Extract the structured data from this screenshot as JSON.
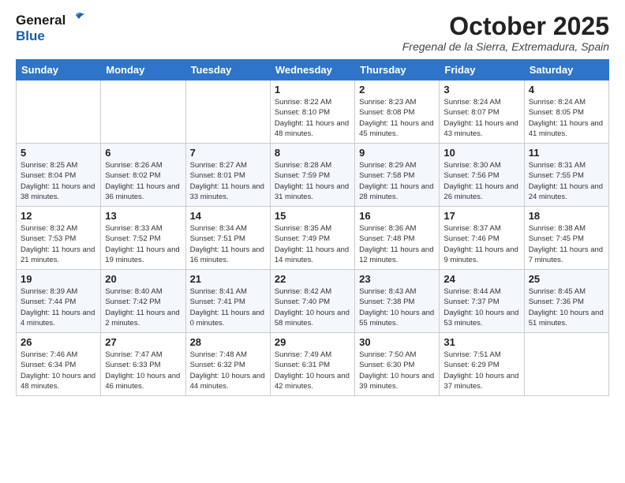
{
  "header": {
    "logo_general": "General",
    "logo_blue": "Blue",
    "month_title": "October 2025",
    "subtitle": "Fregenal de la Sierra, Extremadura, Spain"
  },
  "days_of_week": [
    "Sunday",
    "Monday",
    "Tuesday",
    "Wednesday",
    "Thursday",
    "Friday",
    "Saturday"
  ],
  "weeks": [
    {
      "cells": [
        {
          "day": "",
          "info": ""
        },
        {
          "day": "",
          "info": ""
        },
        {
          "day": "",
          "info": ""
        },
        {
          "day": "1",
          "info": "Sunrise: 8:22 AM\nSunset: 8:10 PM\nDaylight: 11 hours and 48 minutes."
        },
        {
          "day": "2",
          "info": "Sunrise: 8:23 AM\nSunset: 8:08 PM\nDaylight: 11 hours and 45 minutes."
        },
        {
          "day": "3",
          "info": "Sunrise: 8:24 AM\nSunset: 8:07 PM\nDaylight: 11 hours and 43 minutes."
        },
        {
          "day": "4",
          "info": "Sunrise: 8:24 AM\nSunset: 8:05 PM\nDaylight: 11 hours and 41 minutes."
        }
      ]
    },
    {
      "cells": [
        {
          "day": "5",
          "info": "Sunrise: 8:25 AM\nSunset: 8:04 PM\nDaylight: 11 hours and 38 minutes."
        },
        {
          "day": "6",
          "info": "Sunrise: 8:26 AM\nSunset: 8:02 PM\nDaylight: 11 hours and 36 minutes."
        },
        {
          "day": "7",
          "info": "Sunrise: 8:27 AM\nSunset: 8:01 PM\nDaylight: 11 hours and 33 minutes."
        },
        {
          "day": "8",
          "info": "Sunrise: 8:28 AM\nSunset: 7:59 PM\nDaylight: 11 hours and 31 minutes."
        },
        {
          "day": "9",
          "info": "Sunrise: 8:29 AM\nSunset: 7:58 PM\nDaylight: 11 hours and 28 minutes."
        },
        {
          "day": "10",
          "info": "Sunrise: 8:30 AM\nSunset: 7:56 PM\nDaylight: 11 hours and 26 minutes."
        },
        {
          "day": "11",
          "info": "Sunrise: 8:31 AM\nSunset: 7:55 PM\nDaylight: 11 hours and 24 minutes."
        }
      ]
    },
    {
      "cells": [
        {
          "day": "12",
          "info": "Sunrise: 8:32 AM\nSunset: 7:53 PM\nDaylight: 11 hours and 21 minutes."
        },
        {
          "day": "13",
          "info": "Sunrise: 8:33 AM\nSunset: 7:52 PM\nDaylight: 11 hours and 19 minutes."
        },
        {
          "day": "14",
          "info": "Sunrise: 8:34 AM\nSunset: 7:51 PM\nDaylight: 11 hours and 16 minutes."
        },
        {
          "day": "15",
          "info": "Sunrise: 8:35 AM\nSunset: 7:49 PM\nDaylight: 11 hours and 14 minutes."
        },
        {
          "day": "16",
          "info": "Sunrise: 8:36 AM\nSunset: 7:48 PM\nDaylight: 11 hours and 12 minutes."
        },
        {
          "day": "17",
          "info": "Sunrise: 8:37 AM\nSunset: 7:46 PM\nDaylight: 11 hours and 9 minutes."
        },
        {
          "day": "18",
          "info": "Sunrise: 8:38 AM\nSunset: 7:45 PM\nDaylight: 11 hours and 7 minutes."
        }
      ]
    },
    {
      "cells": [
        {
          "day": "19",
          "info": "Sunrise: 8:39 AM\nSunset: 7:44 PM\nDaylight: 11 hours and 4 minutes."
        },
        {
          "day": "20",
          "info": "Sunrise: 8:40 AM\nSunset: 7:42 PM\nDaylight: 11 hours and 2 minutes."
        },
        {
          "day": "21",
          "info": "Sunrise: 8:41 AM\nSunset: 7:41 PM\nDaylight: 11 hours and 0 minutes."
        },
        {
          "day": "22",
          "info": "Sunrise: 8:42 AM\nSunset: 7:40 PM\nDaylight: 10 hours and 58 minutes."
        },
        {
          "day": "23",
          "info": "Sunrise: 8:43 AM\nSunset: 7:38 PM\nDaylight: 10 hours and 55 minutes."
        },
        {
          "day": "24",
          "info": "Sunrise: 8:44 AM\nSunset: 7:37 PM\nDaylight: 10 hours and 53 minutes."
        },
        {
          "day": "25",
          "info": "Sunrise: 8:45 AM\nSunset: 7:36 PM\nDaylight: 10 hours and 51 minutes."
        }
      ]
    },
    {
      "cells": [
        {
          "day": "26",
          "info": "Sunrise: 7:46 AM\nSunset: 6:34 PM\nDaylight: 10 hours and 48 minutes."
        },
        {
          "day": "27",
          "info": "Sunrise: 7:47 AM\nSunset: 6:33 PM\nDaylight: 10 hours and 46 minutes."
        },
        {
          "day": "28",
          "info": "Sunrise: 7:48 AM\nSunset: 6:32 PM\nDaylight: 10 hours and 44 minutes."
        },
        {
          "day": "29",
          "info": "Sunrise: 7:49 AM\nSunset: 6:31 PM\nDaylight: 10 hours and 42 minutes."
        },
        {
          "day": "30",
          "info": "Sunrise: 7:50 AM\nSunset: 6:30 PM\nDaylight: 10 hours and 39 minutes."
        },
        {
          "day": "31",
          "info": "Sunrise: 7:51 AM\nSunset: 6:29 PM\nDaylight: 10 hours and 37 minutes."
        },
        {
          "day": "",
          "info": ""
        }
      ]
    }
  ]
}
